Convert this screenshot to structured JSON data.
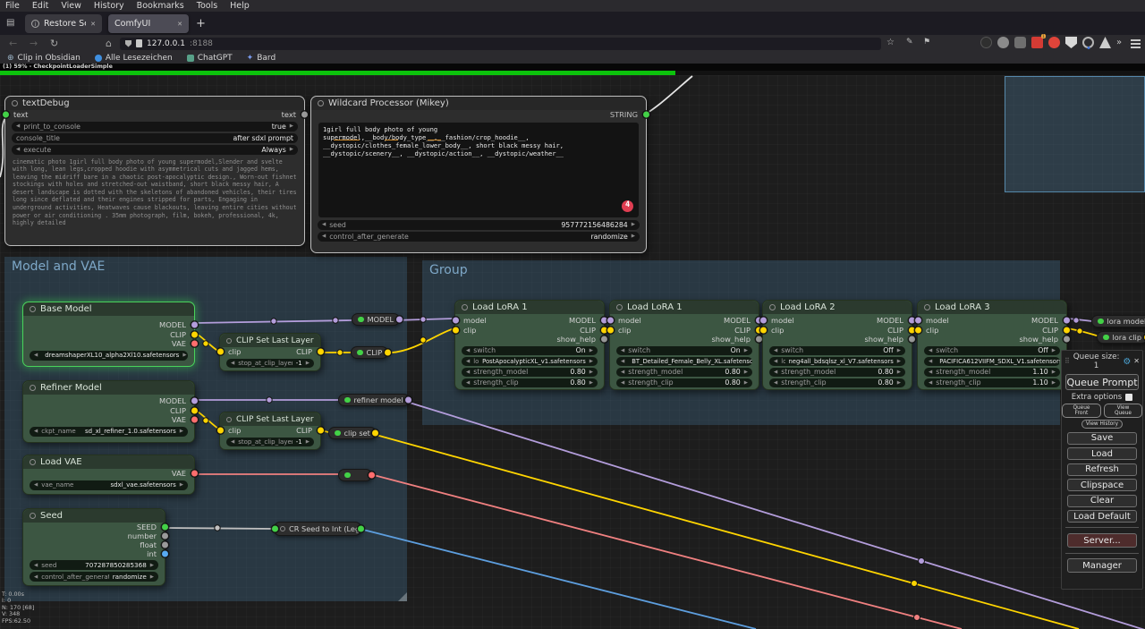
{
  "browser": {
    "menu": [
      "File",
      "Edit",
      "View",
      "History",
      "Bookmarks",
      "Tools",
      "Help"
    ],
    "tab_restore": "Restore Session",
    "tab_comfy": "ComfyUI",
    "url_host": "127.0.0.1",
    "url_port": ":8188",
    "bookmarks": [
      "Clip in Obsidian",
      "Alle Lesezeichen",
      "ChatGPT",
      "Bard"
    ],
    "page_status": "(1) 59% - CheckpointLoaderSimple"
  },
  "groups": {
    "model_vae": "Model and VAE",
    "lora_group": "Group"
  },
  "nodes": {
    "textdebug": {
      "title": "textDebug",
      "input_label": "text",
      "output_label": "text",
      "widgets": [
        {
          "name": "print_to_console",
          "value": "true"
        },
        {
          "name": "console_title",
          "value": "after sdxl prompt"
        },
        {
          "name": "execute",
          "value": "Always"
        }
      ],
      "body": "cinematic photo 1girl full body photo of young supermodel,Slender and svelte with long, lean legs,cropped hoodie with asymmetrical cuts and jagged hems, leaving the midriff bare in a chaotic post-apocalyptic design., Worn-out fishnet stockings with holes and stretched-out waistband, short black messy hair, A desert landscape is dotted with the skeletons of abandoned vehicles, their tires long since deflated and their engines stripped for parts, Engaging in underground activities, Heatwaves cause blackouts, leaving entire cities without power or air conditioning . 35mm photograph, film, bokeh, professional, 4k, highly detailed"
    },
    "wildcard": {
      "title": "Wildcard Processor (Mikey)",
      "output_label": "STRING",
      "badge": "4",
      "prompt": "1girl full body photo of young supermodel,__body/body_type__,__fashion/crop_hoodie__, __dystopic/clothes_female_lower_body__, short black messy hair, __dystopic/scenery__, __dystopic/action__, __dystopic/weather__",
      "widgets": [
        {
          "name": "seed",
          "value": "957772156486284"
        },
        {
          "name": "control_after_generate",
          "value": "randomize"
        }
      ]
    },
    "base_model": {
      "title": "Base Model",
      "outputs": [
        "MODEL",
        "CLIP",
        "VAE"
      ],
      "widgets": [
        {
          "name": "ckpt_name",
          "value": "dreamshaperXL10_alpha2Xl10.safetensors"
        }
      ]
    },
    "clip_set_1": {
      "title": "CLIP Set Last Layer",
      "input_label": "clip",
      "output_label": "CLIP",
      "widgets": [
        {
          "name": "stop_at_clip_layer",
          "value": "-1"
        }
      ]
    },
    "refiner_model": {
      "title": "Refiner Model",
      "outputs": [
        "MODEL",
        "CLIP",
        "VAE"
      ],
      "widgets": [
        {
          "name": "ckpt_name",
          "value": "sd_xl_refiner_1.0.safetensors"
        }
      ]
    },
    "clip_set_2": {
      "title": "CLIP Set Last Layer",
      "input_label": "clip",
      "output_label": "CLIP",
      "widgets": [
        {
          "name": "stop_at_clip_layer",
          "value": "-1"
        }
      ]
    },
    "load_vae": {
      "title": "Load VAE",
      "output_label": "VAE",
      "widgets": [
        {
          "name": "vae_name",
          "value": "sdxl_vae.safetensors"
        }
      ]
    },
    "seed": {
      "title": "Seed",
      "outputs": [
        "SEED",
        "number",
        "float",
        "int"
      ],
      "widgets": [
        {
          "name": "seed",
          "value": "707287850285368"
        },
        {
          "name": "control_after_generate",
          "value": "randomize"
        }
      ]
    },
    "cr_seed_to_int": {
      "title": "CR Seed to Int (Lega"
    },
    "lora1": {
      "title": "Load LoRA 1",
      "inputs": [
        "model",
        "clip"
      ],
      "outputs": [
        "MODEL",
        "CLIP",
        "show_help"
      ],
      "widgets": [
        {
          "name": "switch",
          "value": "On"
        },
        {
          "name": "lora_name",
          "value": "PostApocalypticXL_v1.safetensors"
        },
        {
          "name": "strength_model",
          "value": "0.80"
        },
        {
          "name": "strength_clip",
          "value": "0.80"
        }
      ]
    },
    "lora2": {
      "title": "Load LoRA 1",
      "inputs": [
        "model",
        "clip"
      ],
      "outputs": [
        "MODEL",
        "CLIP",
        "show_help"
      ],
      "widgets": [
        {
          "name": "switch",
          "value": "On"
        },
        {
          "name": "lora_name",
          "value": "BT_Detailed_Female_Belly_XL.safetensors"
        },
        {
          "name": "strength_model",
          "value": "0.80"
        },
        {
          "name": "strength_clip",
          "value": "0.80"
        }
      ]
    },
    "lora3": {
      "title": "Load LoRA 2",
      "inputs": [
        "model",
        "clip"
      ],
      "outputs": [
        "MODEL",
        "CLIP",
        "show_help"
      ],
      "widgets": [
        {
          "name": "switch",
          "value": "Off"
        },
        {
          "name": "lora_name",
          "value": "neg4all_bdsqlsz_xl_V7.safetensors"
        },
        {
          "name": "strength_model",
          "value": "0.80"
        },
        {
          "name": "strength_clip",
          "value": "0.80"
        }
      ]
    },
    "lora4": {
      "title": "Load LoRA 3",
      "inputs": [
        "model",
        "clip"
      ],
      "outputs": [
        "MODEL",
        "CLIP",
        "show_help"
      ],
      "widgets": [
        {
          "name": "switch",
          "value": "Off"
        },
        {
          "name": "lora_name",
          "value": "PACIFICA612VIIFM_SDXL_V1.safetensors"
        },
        {
          "name": "strength_model",
          "value": "1.10"
        },
        {
          "name": "strength_clip",
          "value": "1.10"
        }
      ]
    },
    "reroutes": {
      "model": "MODEL",
      "clip": "CLIP",
      "refiner_model": "refiner model",
      "clip_set": "clip set",
      "lora_model": "lora model",
      "lora_clip": "lora clip"
    }
  },
  "sidebar": {
    "queue_size": "Queue size: 1",
    "queue_prompt": "Queue Prompt",
    "extra_options": "Extra options",
    "queue_front": "Queue Front",
    "view_queue": "View Queue",
    "view_history": "View History",
    "buttons": [
      "Save",
      "Load",
      "Refresh",
      "Clipspace",
      "Clear",
      "Load Default"
    ],
    "server": "Server...",
    "manager": "Manager"
  },
  "stats": [
    "T: 0.00s",
    "I: 0",
    "N: 170 [68]",
    "V: 348",
    "FPS:62.50"
  ]
}
